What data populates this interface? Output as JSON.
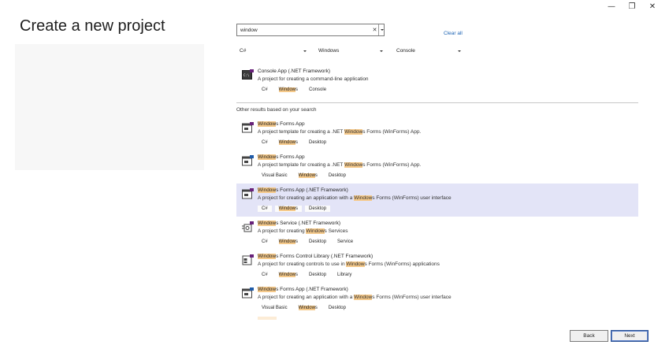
{
  "window": {
    "minimize": "—",
    "restore": "❐",
    "close": "✕"
  },
  "title": "Create a new project",
  "search": {
    "value": "window",
    "clear": "✕"
  },
  "clear_all": "Clear all",
  "filters": {
    "language": "C#",
    "platform": "Windows",
    "project_type": "Console"
  },
  "top_result": {
    "name": "Console App (.NET Framework)",
    "description": "A project for creating a command-line application",
    "icon": "console-app-icon",
    "tags": [
      {
        "pre": "C#"
      },
      {
        "hl": "Window",
        "post": "s"
      },
      {
        "pre": "Console"
      }
    ]
  },
  "other_results_label": "Other results based on your search",
  "results": [
    {
      "icon": "windows-forms-cs-icon",
      "name": {
        "hl": "Window",
        "post": "s Forms App"
      },
      "desc": {
        "pre": "A project template for creating a .NET ",
        "hl": "Window",
        "post": "s Forms (WinForms) App."
      },
      "tags": [
        {
          "pre": "C#"
        },
        {
          "hl": "Window",
          "post": "s"
        },
        {
          "pre": "Desktop"
        }
      ]
    },
    {
      "icon": "windows-forms-vb-icon",
      "name": {
        "hl": "Window",
        "post": "s Forms App"
      },
      "desc": {
        "pre": "A project template for creating a .NET ",
        "hl": "Window",
        "post": "s Forms (WinForms) App."
      },
      "tags": [
        {
          "pre": "Visual Basic"
        },
        {
          "hl": "Window",
          "post": "s"
        },
        {
          "pre": "Desktop"
        }
      ]
    },
    {
      "icon": "windows-forms-cs-icon",
      "selected": true,
      "name": {
        "hl": "Window",
        "post": "s Forms App (.NET Framework)"
      },
      "desc": {
        "pre": "A project for creating an application with a ",
        "hl": "Window",
        "post": "s Forms (WinForms) user interface"
      },
      "tags": [
        {
          "pre": "C#"
        },
        {
          "hl": "Window",
          "post": "s"
        },
        {
          "pre": "Desktop"
        }
      ]
    },
    {
      "icon": "windows-service-icon",
      "name": {
        "hl": "Window",
        "post": "s Service (.NET Framework)"
      },
      "desc": {
        "pre": "A project for creating ",
        "hl": "Window",
        "post": "s Services"
      },
      "tags": [
        {
          "pre": "C#"
        },
        {
          "hl": "Window",
          "post": "s"
        },
        {
          "pre": "Desktop"
        },
        {
          "pre": "Service"
        }
      ]
    },
    {
      "icon": "control-library-icon",
      "name": {
        "hl": "Window",
        "post": "s Forms Control Library (.NET Framework)"
      },
      "desc": {
        "pre": "A project for creating controls to use in ",
        "hl": "Window",
        "post": "s Forms (WinForms) applications"
      },
      "tags": [
        {
          "pre": "C#"
        },
        {
          "hl": "Window",
          "post": "s"
        },
        {
          "pre": "Desktop"
        },
        {
          "pre": "Library"
        }
      ]
    },
    {
      "icon": "windows-forms-vb-icon",
      "name": {
        "hl": "Window",
        "post": "s Forms App (.NET Framework)"
      },
      "desc": {
        "pre": "A project for creating an application with a ",
        "hl": "Window",
        "post": "s Forms (WinForms) user interface"
      },
      "tags": [
        {
          "pre": "Visual Basic"
        },
        {
          "hl": "Window",
          "post": "s"
        },
        {
          "pre": "Desktop"
        }
      ]
    }
  ],
  "buttons": {
    "back": "Back",
    "next": "Next"
  },
  "colors": {
    "highlight": "#f5c98a",
    "selected_row": "#e3e4f7",
    "link": "#1a62b3"
  }
}
